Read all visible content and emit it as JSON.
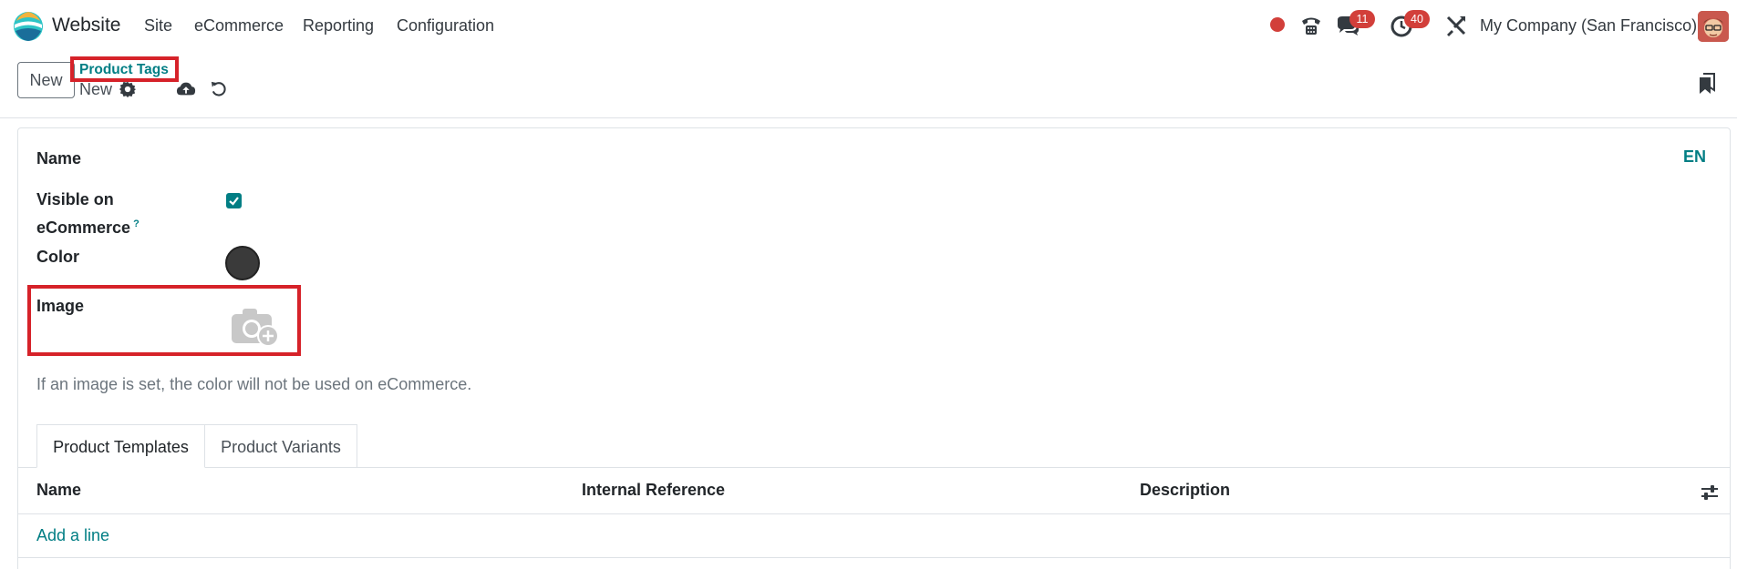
{
  "navbar": {
    "app_name": "Website",
    "menu": [
      "Site",
      "eCommerce",
      "Reporting",
      "Configuration"
    ],
    "messages_count": "11",
    "activities_count": "40",
    "company": "My Company (San Francisco)"
  },
  "control_panel": {
    "new_button": "New",
    "breadcrumb": "Product Tags",
    "record_name": "New"
  },
  "form": {
    "name_label": "Name",
    "language": "EN",
    "visible_label_line1": "Visible on",
    "visible_label_line2": "eCommerce",
    "visible_help": "?",
    "visible_checked": true,
    "color_label": "Color",
    "color_value": "#3a3a3a",
    "image_label": "Image",
    "help_text": "If an image is set, the color will not be used on eCommerce."
  },
  "tabs": {
    "product_templates": "Product Templates",
    "product_variants": "Product Variants"
  },
  "list": {
    "columns": [
      "Name",
      "Internal Reference",
      "Description"
    ],
    "add_line": "Add a line"
  },
  "colors": {
    "accent": "#017e84",
    "badge": "#d23f3a",
    "highlight": "#d62229"
  }
}
